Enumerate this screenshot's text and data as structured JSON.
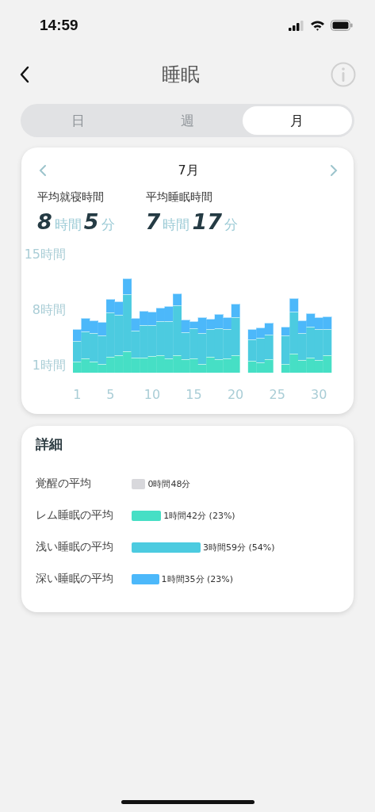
{
  "status_bar": {
    "time": "14:59"
  },
  "header": {
    "title": "睡眠"
  },
  "tabs": [
    {
      "label": "日",
      "selected": false
    },
    {
      "label": "週",
      "selected": false
    },
    {
      "label": "月",
      "selected": true
    }
  ],
  "summary": {
    "period": "7月",
    "stats": [
      {
        "label": "平均就寝時間",
        "hours": "8",
        "hours_unit": "時間",
        "minutes": "5",
        "minutes_unit": "分"
      },
      {
        "label": "平均睡眠時間",
        "hours": "7",
        "hours_unit": "時間",
        "minutes": "17",
        "minutes_unit": "分"
      }
    ],
    "chart_data": {
      "type": "bar",
      "stacked": true,
      "x": [
        1,
        2,
        3,
        4,
        5,
        6,
        7,
        8,
        9,
        10,
        11,
        12,
        13,
        14,
        15,
        16,
        17,
        18,
        19,
        20,
        21,
        22,
        23,
        24,
        25,
        26,
        27,
        28,
        29,
        30,
        31
      ],
      "series": [
        {
          "color": "#46dfc5",
          "values": [
            1.4,
            1.8,
            1.4,
            1.1,
            2.0,
            2.2,
            2.7,
            1.9,
            1.9,
            2.1,
            2.2,
            1.8,
            2.2,
            1.7,
            1.8,
            1.1,
            2.0,
            1.7,
            1.8,
            2.2,
            null,
            1.5,
            1.3,
            1.7,
            null,
            1.1,
            2.4,
            1.6,
            1.9,
            1.6,
            2.2
          ]
        },
        {
          "color": "#4ccbe0",
          "values": [
            2.6,
            3.4,
            3.6,
            3.6,
            5.6,
            5.1,
            7.2,
            3.4,
            4.1,
            3.9,
            4.3,
            4.7,
            6.3,
            3.4,
            3.8,
            3.9,
            3.5,
            3.9,
            3.7,
            4.8,
            null,
            2.7,
            3.1,
            3.1,
            null,
            3.6,
            5.3,
            3.4,
            3.9,
            3.9,
            3.3
          ]
        },
        {
          "color": "#4cb8fa",
          "values": [
            1.5,
            1.7,
            1.6,
            1.7,
            1.7,
            1.7,
            2.0,
            1.6,
            1.8,
            1.7,
            1.7,
            1.9,
            1.5,
            1.6,
            0.9,
            2.0,
            1.3,
            1.8,
            1.5,
            1.7,
            null,
            1.3,
            1.3,
            1.5,
            null,
            1.1,
            1.7,
            1.6,
            1.7,
            1.5,
            1.6
          ]
        }
      ],
      "xlim": [
        0.5,
        31.5
      ],
      "ylim": [
        0,
        15
      ],
      "yticks": [
        {
          "value": 1,
          "label": "1時間"
        },
        {
          "value": 8,
          "label": "8時間"
        },
        {
          "value": 15,
          "label": "15時間"
        }
      ],
      "xticks": [
        1,
        5,
        10,
        15,
        20,
        25,
        30
      ]
    }
  },
  "details": {
    "title": "詳細",
    "rows": [
      {
        "label": "覚醒の平均",
        "value": "0時間48分",
        "color": "#d8d8dc"
      },
      {
        "label": "レム睡眠の平均",
        "value": "1時間42分 (23%)",
        "color": "#46dfc5"
      },
      {
        "label": "浅い睡眠の平均",
        "value": "3時間59分 (54%)",
        "color": "#4ccbe0"
      },
      {
        "label": "深い睡眠の平均",
        "value": "1時間35分 (23%)",
        "color": "#4cb8fa"
      }
    ]
  }
}
